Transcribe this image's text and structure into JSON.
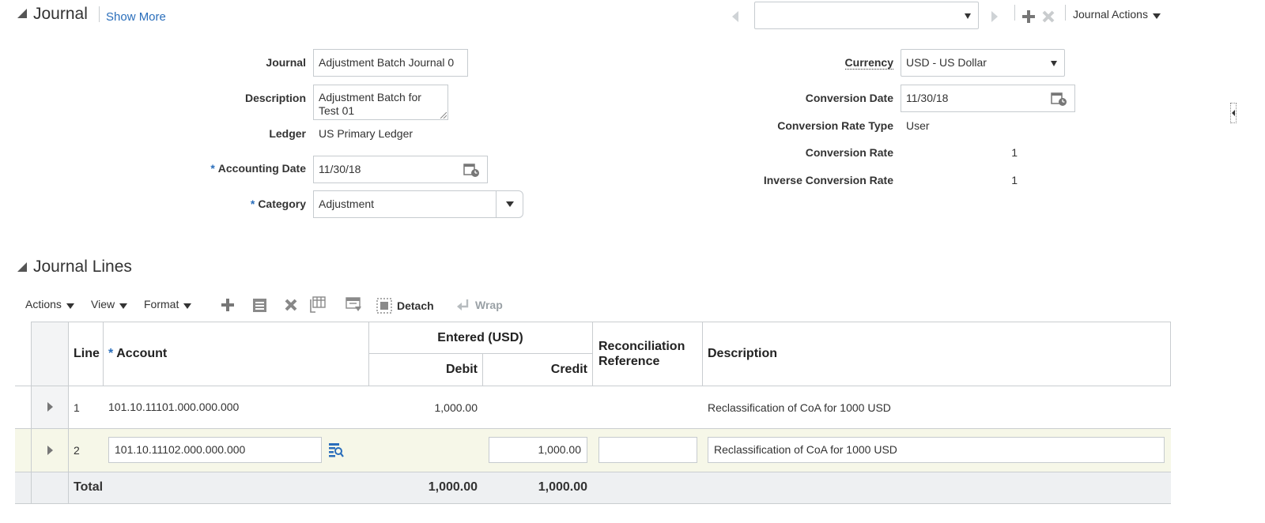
{
  "journal_section": {
    "title": "Journal",
    "show_more": "Show More",
    "navigator_select_value": "",
    "actions_menu": "Journal Actions",
    "fields": {
      "journal_label": "Journal",
      "journal_value": "Adjustment Batch Journal 0",
      "description_label": "Description",
      "description_value": "Adjustment Batch for Test 01",
      "ledger_label": "Ledger",
      "ledger_value": "US Primary Ledger",
      "accounting_date_label": "Accounting Date",
      "accounting_date_value": "11/30/18",
      "category_label": "Category",
      "category_value": "Adjustment",
      "currency_label": "Currency",
      "currency_value": "USD - US Dollar",
      "conversion_date_label": "Conversion Date",
      "conversion_date_value": "11/30/18",
      "conversion_rate_type_label": "Conversion Rate Type",
      "conversion_rate_type_value": "User",
      "conversion_rate_label": "Conversion Rate",
      "conversion_rate_value": "1",
      "inverse_conversion_rate_label": "Inverse Conversion Rate",
      "inverse_conversion_rate_value": "1"
    }
  },
  "lines_section": {
    "title": "Journal Lines",
    "toolbar": {
      "actions": "Actions",
      "view": "View",
      "format": "Format",
      "detach": "Detach",
      "wrap": "Wrap"
    },
    "columns": {
      "line": "Line",
      "account": "Account",
      "entered_group": "Entered (USD)",
      "debit": "Debit",
      "credit": "Credit",
      "reconciliation_reference": "Reconciliation Reference",
      "description": "Description"
    },
    "rows": [
      {
        "line": "1",
        "account": "101.10.11101.000.000.000",
        "debit": "1,000.00",
        "credit": "",
        "reconciliation_reference": "",
        "description": "Reclassification of CoA for 1000 USD"
      },
      {
        "line": "2",
        "account": "101.10.11102.000.000.000",
        "debit": "",
        "credit": "1,000.00",
        "reconciliation_reference": "",
        "description": "Reclassification of CoA for 1000 USD"
      }
    ],
    "total": {
      "label": "Total",
      "debit": "1,000.00",
      "credit": "1,000.00"
    }
  },
  "colors": {
    "required_marker": "#2a6ebb",
    "selected_row": "#f6f7e8",
    "total_row": "#eef0f2",
    "border": "#c9cdd0"
  }
}
